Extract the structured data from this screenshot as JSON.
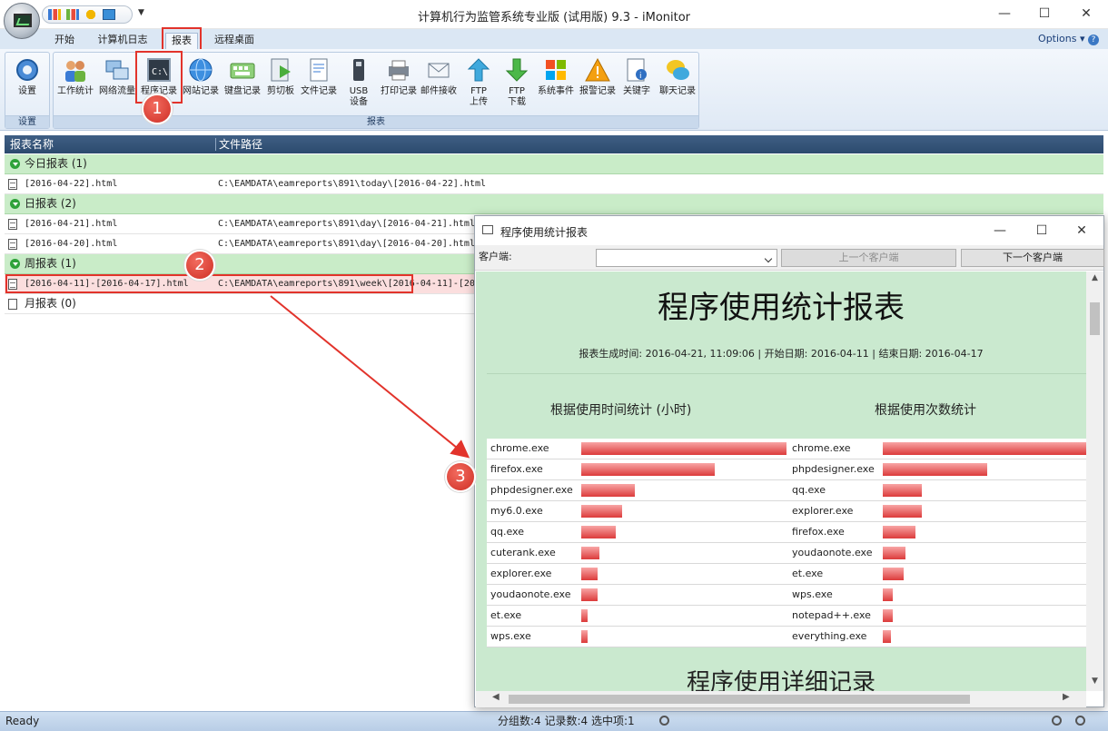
{
  "window": {
    "title": "计算机行为监管系统专业版 (试用版) 9.3 - iMonitor"
  },
  "ribbon": {
    "tabs": [
      {
        "label": "开始"
      },
      {
        "label": "计算机日志"
      },
      {
        "label": "报表"
      },
      {
        "label": "远程桌面"
      }
    ],
    "options_label": "Options",
    "settings_group_label": "设置",
    "settings_button": "设置",
    "reports_group_label": "报表",
    "buttons": [
      "工作统计",
      "网络流量",
      "程序记录",
      "网站记录",
      "键盘记录",
      "剪切板",
      "文件记录",
      "USB",
      "设备",
      "打印记录",
      "邮件接收",
      "FTP",
      "上传",
      "FTP",
      "下载",
      "系统事件",
      "报警记录",
      "关键字",
      "聊天记录"
    ]
  },
  "badges": [
    "1",
    "2",
    "3"
  ],
  "list": {
    "columns": [
      "报表名称",
      "文件路径"
    ],
    "groups": [
      {
        "label": "今日报表 (1)"
      },
      {
        "label": "日报表 (2)"
      },
      {
        "label": "周报表 (1)"
      },
      {
        "label": "月报表 (0)"
      }
    ],
    "files": [
      {
        "name": "[2016-04-22].html",
        "path": "C:\\EAMDATA\\eamreports\\891\\today\\[2016-04-22].html"
      },
      {
        "name": "[2016-04-21].html",
        "path": "C:\\EAMDATA\\eamreports\\891\\day\\[2016-04-21].html"
      },
      {
        "name": "[2016-04-20].html",
        "path": "C:\\EAMDATA\\eamreports\\891\\day\\[2016-04-20].html"
      },
      {
        "name": "[2016-04-11]-[2016-04-17].html",
        "path": "C:\\EAMDATA\\eamreports\\891\\week\\[2016-04-11]-[20"
      }
    ]
  },
  "statusbar": {
    "ready": "Ready",
    "stats": "分组数:4  记录数:4  选中项:1"
  },
  "popup": {
    "title": "程序使用统计报表",
    "client_label": "客户端:",
    "prev_button": "上一个客户端",
    "next_button": "下一个客户端",
    "report_title": "程序使用统计报表",
    "report_meta": "报表生成时间: 2016-04-21, 11:09:06 | 开始日期: 2016-04-11 | 结束日期: 2016-04-17",
    "time_heading": "根据使用时间统计 (小时)",
    "count_heading": "根据使用次数统计",
    "detail_title": "程序使用详细记录"
  },
  "colors": {
    "bar": "#dc3b3b",
    "report_bg": "#cae9cf",
    "highlight": "#e2332b",
    "group_bg": "#c9ecc8"
  },
  "chart_data": [
    {
      "type": "bar",
      "title": "根据使用时间统计 (小时)",
      "categories": [
        "chrome.exe",
        "firefox.exe",
        "phpdesigner.exe",
        "my6.0.exe",
        "qq.exe",
        "cuterank.exe",
        "explorer.exe",
        "youdaonote.exe",
        "et.exe",
        "wps.exe"
      ],
      "values": [
        100,
        65,
        26,
        20,
        17,
        9,
        8,
        8,
        3,
        3
      ]
    },
    {
      "type": "bar",
      "title": "根据使用次数统计",
      "categories": [
        "chrome.exe",
        "phpdesigner.exe",
        "qq.exe",
        "explorer.exe",
        "firefox.exe",
        "youdaonote.exe",
        "et.exe",
        "wps.exe",
        "notepad++.exe",
        "everything.exe"
      ],
      "values": [
        100,
        51,
        19,
        19,
        16,
        11,
        10,
        5,
        5,
        4
      ]
    }
  ]
}
